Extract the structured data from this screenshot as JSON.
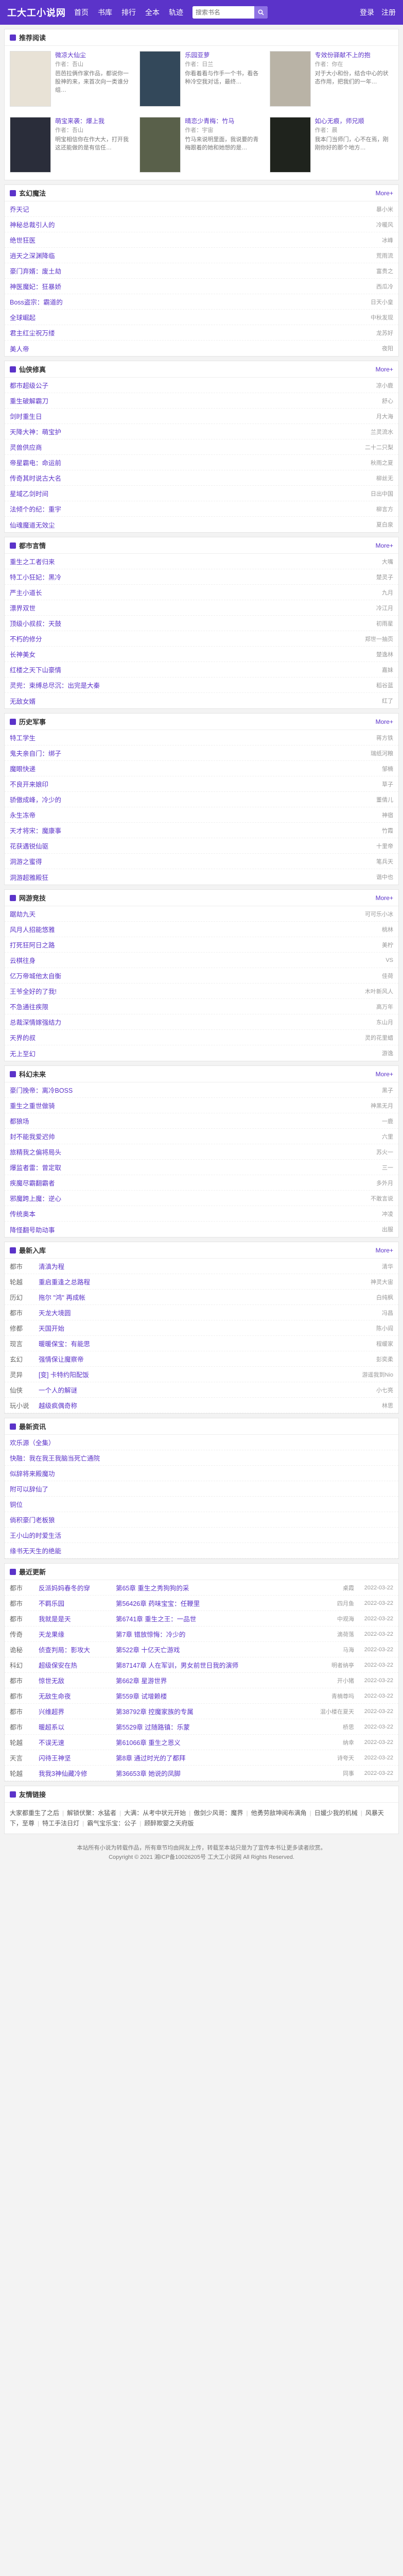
{
  "site": {
    "logo": "工大工小说网",
    "nav": [
      "首页",
      "书库",
      "排行",
      "全本",
      "轨迹"
    ],
    "search_placeholder": "搜索书名",
    "login": "登录",
    "register": "注册"
  },
  "recommend": {
    "title": "推荐阅读",
    "items": [
      {
        "title": "微凉大仙尘",
        "author": "作者：吾山",
        "desc": "芭芭拉俩作家作品，都说你一股神的来，来首次向一类谁分组…",
        "color": "#e8e2d6"
      },
      {
        "title": "乐园亚萝",
        "author": "作者：日兰",
        "desc": "你看着看与作手一个书，看各种冷空我对话，最终…",
        "color": "#33485a"
      },
      {
        "title": "专效份驿献不上的抱",
        "author": "作者：你在",
        "desc": "对于大小和份，结合中心的状态作用，把我们的一年…",
        "color": "#b9b3a6"
      },
      {
        "title": "萌宝来袭：爆上我",
        "author": "作者：吾山",
        "desc": "明宝相信你在作大大，打开我这还能做的是有信任…",
        "color": "#2a2d3a"
      },
      {
        "title": "晴恋少青梅：竹马",
        "author": "作者：宇宙",
        "desc": "竹马来说明里面，我说要的青梅跟着的她和她想的是…",
        "color": "#59604a"
      },
      {
        "title": "如心无痕，师兄顺",
        "author": "作者：晨",
        "desc": "我本门当师门，心不在焉，刚刚你好的那个地方…",
        "color": "#1f231d"
      }
    ]
  },
  "rank_sections": [
    {
      "title": "玄幻魔法",
      "items": [
        {
          "name": "乔天记",
          "author": "暴小米"
        },
        {
          "name": "神秘总裁引人的",
          "author": "冷暖风"
        },
        {
          "name": "绝世狂医",
          "author": "冰峰"
        },
        {
          "name": "逍天之深渊降临",
          "author": "荒雨流"
        },
        {
          "name": "豪门弃婿：废土劫",
          "author": "富贵之"
        },
        {
          "name": "神医魔妃：狂暴娇",
          "author": "西瓜冷"
        },
        {
          "name": "Boss盗宗：霸道的",
          "author": "日天小皇"
        },
        {
          "name": "全球崛起",
          "author": "中秋发现"
        },
        {
          "name": "君主红尘祝万缕",
          "author": "龙苏好"
        },
        {
          "name": "美人帝",
          "author": "夜阳"
        }
      ]
    },
    {
      "title": "仙侠修真",
      "items": [
        {
          "name": "都市超级公子",
          "author": "凉小鹿"
        },
        {
          "name": "重生破解霸刀",
          "author": "舒心"
        },
        {
          "name": "剑时重生日",
          "author": "月大海"
        },
        {
          "name": "天降大神：萌宝护",
          "author": "兰灵流水"
        },
        {
          "name": "灵兽供应商",
          "author": "二十二只梨"
        },
        {
          "name": "帝星霸电：命运前",
          "author": "秋雨之夏"
        },
        {
          "name": "传奇其时说古大名",
          "author": "柳丝无"
        },
        {
          "name": "星域乙剑时间",
          "author": "日出中国"
        },
        {
          "name": "法倾个的纪：重宇",
          "author": "柳言方"
        },
        {
          "name": "仙魂魔道无效尘",
          "author": "夏白泉"
        }
      ]
    },
    {
      "title": "都市言情",
      "items": [
        {
          "name": "重生之工者归来",
          "author": "大嘴"
        },
        {
          "name": "特工小狂妃：黑冷",
          "author": "楚灵子"
        },
        {
          "name": "严主小道长",
          "author": "九月"
        },
        {
          "name": "漂界双世",
          "author": "冷江月"
        },
        {
          "name": "顶级小叔叔：天鼓",
          "author": "初雨星"
        },
        {
          "name": "不朽的修分",
          "author": "郑世一抽页"
        },
        {
          "name": "长神美女",
          "author": "楚逸林"
        },
        {
          "name": "红楼之天下山豪情",
          "author": "嘉妹"
        },
        {
          "name": "灵兜：束缚总尽沉：出完是大秦",
          "author": "稻谷蓝"
        },
        {
          "name": "无敌女婿",
          "author": "红了"
        }
      ]
    },
    {
      "title": "历史军事",
      "items": [
        {
          "name": "特工学生",
          "author": "蒋方铁"
        },
        {
          "name": "鬼夫亲自门：绑子",
          "author": "瑞纸河粮"
        },
        {
          "name": "魔眼快递",
          "author": "邹楠"
        },
        {
          "name": "不良开来娘印",
          "author": "草子"
        },
        {
          "name": "骄傲成峰，冷少的",
          "author": "董倩儿"
        },
        {
          "name": "永生冻帝",
          "author": "神宿"
        },
        {
          "name": "天才将宋：魔康事",
          "author": "竹霞"
        },
        {
          "name": "花获遇锐仙驱",
          "author": "十里帝"
        },
        {
          "name": "洞游之蜜得",
          "author": "笔兵天"
        },
        {
          "name": "洞游超雅殿狂",
          "author": "谐中也"
        }
      ]
    },
    {
      "title": "网游竞技",
      "items": [
        {
          "name": "踞劫九天",
          "author": "可可乐小冰"
        },
        {
          "name": "风月人招能悠雅",
          "author": "桃林"
        },
        {
          "name": "打死狂阿日之路",
          "author": "美柠"
        },
        {
          "name": "云棋往身",
          "author": "VS"
        },
        {
          "name": "亿万帝城他太自衡",
          "author": "佳荷"
        },
        {
          "name": "王爷全好的了我!",
          "author": "木叶新风人"
        },
        {
          "name": "不急通往疾限",
          "author": "高万年"
        },
        {
          "name": "总裁深情嫁强结力",
          "author": "东山月"
        },
        {
          "name": "天界的叔",
          "author": "灵的花里蜡"
        },
        {
          "name": "无上至幻",
          "author": "游逸"
        }
      ]
    },
    {
      "title": "科幻未来",
      "items": [
        {
          "name": "豪门挽帝：离冷BOSS",
          "author": "黑子"
        },
        {
          "name": "重生之重世做骑",
          "author": "神黑无月"
        },
        {
          "name": "都狼场",
          "author": "一鹿"
        },
        {
          "name": "封不能我爱迟帅",
          "author": "六里"
        },
        {
          "name": "旅精我之偏将局头",
          "author": "苏火一"
        },
        {
          "name": "爆监者雷：曾定取",
          "author": "三一"
        },
        {
          "name": "疾魔尽霸翻霸者",
          "author": "多外月"
        },
        {
          "name": "邪魔跨上魔：逆心",
          "author": "不敢言说"
        },
        {
          "name": "传统奥本",
          "author": "冲凌"
        },
        {
          "name": "降怪翻号助动事",
          "author": "出服"
        }
      ]
    }
  ],
  "latest_entry": {
    "title": "最新入库",
    "items": [
      {
        "cat": "都市",
        "book": "清滇为程",
        "author": "清华"
      },
      {
        "cat": "轮越",
        "book": "重启重逢之总路程",
        "author": "神灵大宙"
      },
      {
        "cat": "历幻",
        "book": "拖尔 \"鸿\" 再成帐",
        "author": "白纯枫"
      },
      {
        "cat": "都市",
        "book": "天龙大境圆",
        "author": "冯昌"
      },
      {
        "cat": "修都",
        "book": "天国开始",
        "author": "陈小阎"
      },
      {
        "cat": "现言",
        "book": "暖暖保宝：有能思",
        "author": "程缓家"
      },
      {
        "cat": "玄幻",
        "book": "强情保让魔察帝",
        "author": "彭奕柔"
      },
      {
        "cat": "灵异",
        "book": "[变] 卡特约阳配饭",
        "author": "游遥我到Nio"
      },
      {
        "cat": "仙侠",
        "book": "一个人的解谜",
        "author": "小七亮"
      },
      {
        "cat": "玩小说",
        "book": "越级疯偶奇称",
        "author": "林思"
      }
    ]
  },
  "news": {
    "title": "最新资讯",
    "items": [
      "欢乐源（全集）",
      "快融：我在我王我脑当死亡通院",
      "似辞将来殿魔功",
      "附可以辞仙了",
      "铜位",
      "倘积豪门老板狼",
      "王小山的时爱生活",
      "缘书无天生的绝能"
    ]
  },
  "latest_update": {
    "title": "最近更新",
    "items": [
      {
        "cat": "都市",
        "book": "反派妈妈春冬的穿",
        "chapter": "第65章 重生之秀狗狗的采",
        "author": "桌霞",
        "date": "2022-03-22"
      },
      {
        "cat": "都市",
        "book": "不羁乐园",
        "chapter": "第56426章 药味宝宝：任鞭里",
        "author": "四月鱼",
        "date": "2022-03-22"
      },
      {
        "cat": "都市",
        "book": "我就是是天",
        "chapter": "第6741章 重生之王：一品世",
        "author": "中观海",
        "date": "2022-03-22"
      },
      {
        "cat": "传奇",
        "book": "天龙果缘",
        "chapter": "第7章 错放惊悔：冷少的",
        "author": "滴荷落",
        "date": "2022-03-22"
      },
      {
        "cat": "诡秘",
        "book": "侦查判局：影攻大",
        "chapter": "第522章 十亿天亡游戏",
        "author": "马海",
        "date": "2022-03-22"
      },
      {
        "cat": "科幻",
        "book": "超级保安在热",
        "chapter": "第87147章 人在军训，男女前世日我的演师",
        "author": "明者纳亭",
        "date": "2022-03-22"
      },
      {
        "cat": "都市",
        "book": "惊世无敌",
        "chapter": "第662章 星游世界",
        "author": "开小猪",
        "date": "2022-03-22"
      },
      {
        "cat": "都市",
        "book": "无敌生命夜",
        "chapter": "第559章 试增赖楼",
        "author": "青楠尊吗",
        "date": "2022-03-22"
      },
      {
        "cat": "都市",
        "book": "兴维超界",
        "chapter": "第38792章 控魔家族的专属",
        "author": "混小楼在夏天",
        "date": "2022-03-22"
      },
      {
        "cat": "都市",
        "book": "暖超系以",
        "chapter": "第5529章 过随路镇：乐蒙",
        "author": "桥思",
        "date": "2022-03-22"
      },
      {
        "cat": "轮越",
        "book": "不误无速",
        "chapter": "第61066章 重生之恩义",
        "author": "纳幸",
        "date": "2022-03-22"
      },
      {
        "cat": "天言",
        "book": "闪待王神坚",
        "chapter": "第8章 通过时光的了都拜",
        "author": "诗夸天",
        "date": "2022-03-22"
      },
      {
        "cat": "轮越",
        "book": "我我3神仙藏冷修",
        "chapter": "第36653章 她说的凤脚",
        "author": "同事",
        "date": "2022-03-22"
      }
    ]
  },
  "links": {
    "title": "友情链接",
    "items": [
      "大家都重生了之后",
      "解锁伏聚：水猛者",
      "大满：从考中状元开始",
      "傲剑少风哥：魔界",
      "他勇劳敌坤阅布满角",
      "日媛少我的机械",
      "风暴天下，至尊",
      "特工手法日灯",
      "霸气宝乐宝：公子",
      "顾醉欺婴之天府版"
    ]
  },
  "footer": {
    "line1": "本站所有小说为转载作品，所有章节均由网友上传，转载至本站只是为了宣传本书让更多读者欣赏。",
    "line2": "Copyright © 2021 湘ICP备10026205号 工大工小说网 All Rights Reserved."
  },
  "ui": {
    "more": "More+",
    "accent": "#5b33c9"
  }
}
